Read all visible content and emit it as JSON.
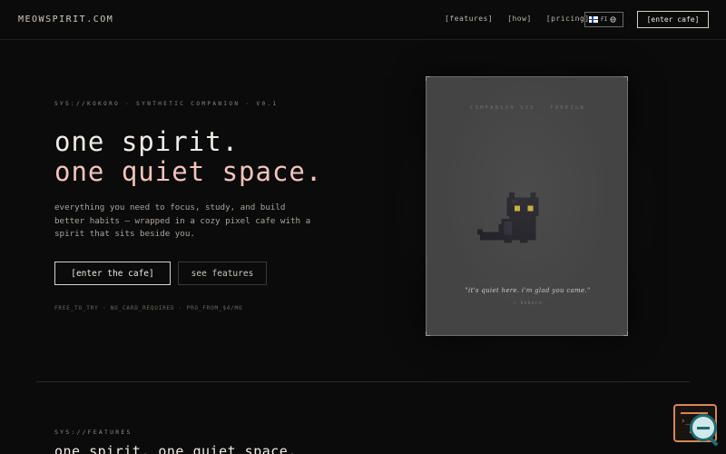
{
  "nav": {
    "brand": "MEOWSPIRIT.COM",
    "links": [
      "[features]",
      "[how]",
      "[pricing]"
    ],
    "lang": {
      "code": "FI",
      "icon": "globe-icon"
    },
    "cta": "[enter cafe]"
  },
  "hero": {
    "eyebrow": "SYS://KOKORO · SYNTHETIC COMPANION · V0.1",
    "title_line1": "one spirit.",
    "title_line2": "one quiet space.",
    "description": "everything you need to focus, study, and build better habits — wrapped in a cozy pixel cafe with a spirit that sits beside you.",
    "primary_button": "[enter the cafe]",
    "secondary_button": "see features",
    "tags": "FREE_TO_TRY · NO_CARD_REQUIRED · PRO_FROM_$4/MO"
  },
  "card": {
    "title": "COMPANION SYS · FOREIGN",
    "quote": "\"it's quiet here. i'm glad you came.\"",
    "signature": "— kokoro"
  },
  "features": {
    "eyebrow": "SYS://FEATURES",
    "title": "one spirit. one quiet space."
  },
  "colors": {
    "background": "#0b0b0b",
    "accent_pink": "#f3c3bd",
    "card_bg": "#444444",
    "cat_eyes": "#f5d33a",
    "widget_orange": "#d8855a"
  }
}
